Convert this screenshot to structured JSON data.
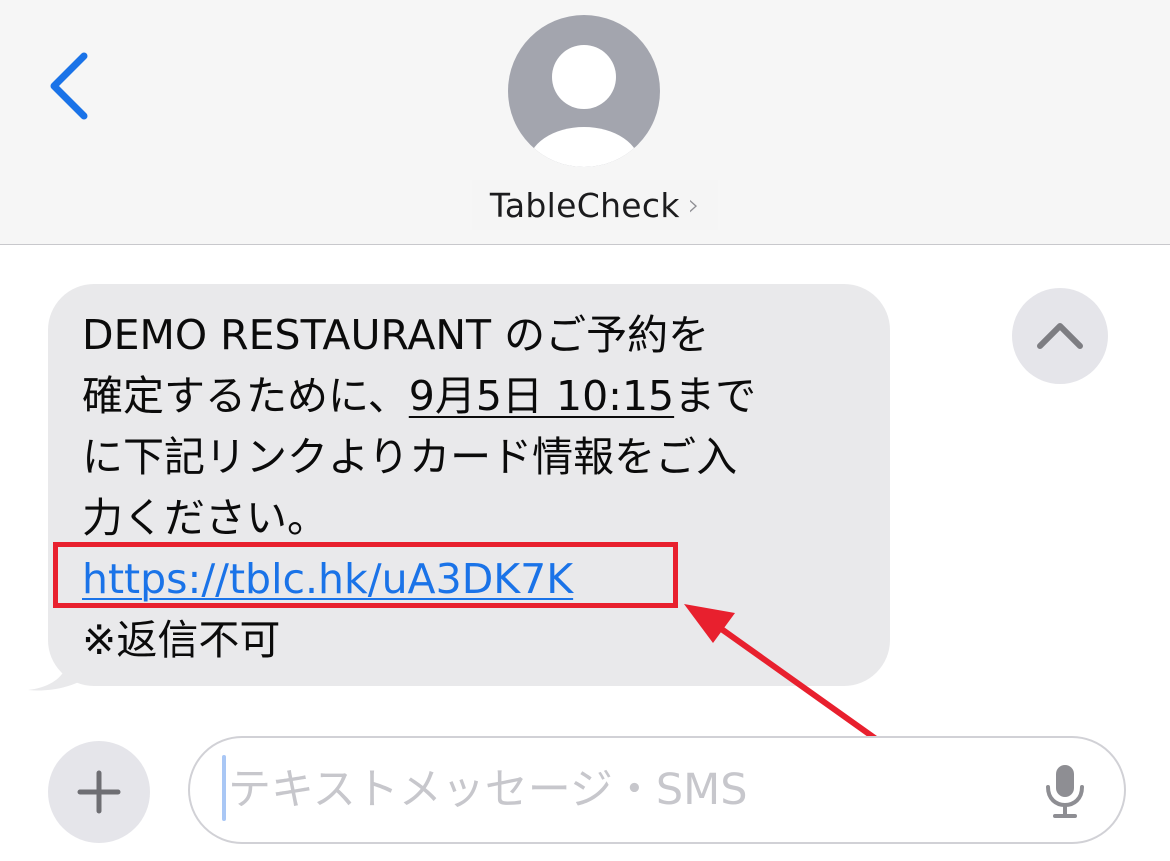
{
  "header": {
    "contact_name": "TableCheck",
    "contact_chevron": "›",
    "back_icon": "chevron-left-icon",
    "avatar_icon": "person-avatar-icon"
  },
  "message": {
    "line1": "DEMO RESTAURANT のご予約を",
    "line2_prefix": "確定するために、",
    "line2_date": "9月5日 10:15",
    "line2_suffix": "まで",
    "line3": "に下記リンクよりカード情報をご入",
    "line4": "力ください。",
    "url": "https://tblc.hk/uA3DK7K",
    "footer": "※返信不可"
  },
  "composer": {
    "placeholder": "テキストメッセージ・SMS",
    "plus_label": "+",
    "mic_icon": "microphone-icon"
  },
  "colors": {
    "link": "#1a73e8",
    "annotation": "#e8202e",
    "bubble": "#e9e9eb",
    "back_chevron": "#1a73e8"
  }
}
